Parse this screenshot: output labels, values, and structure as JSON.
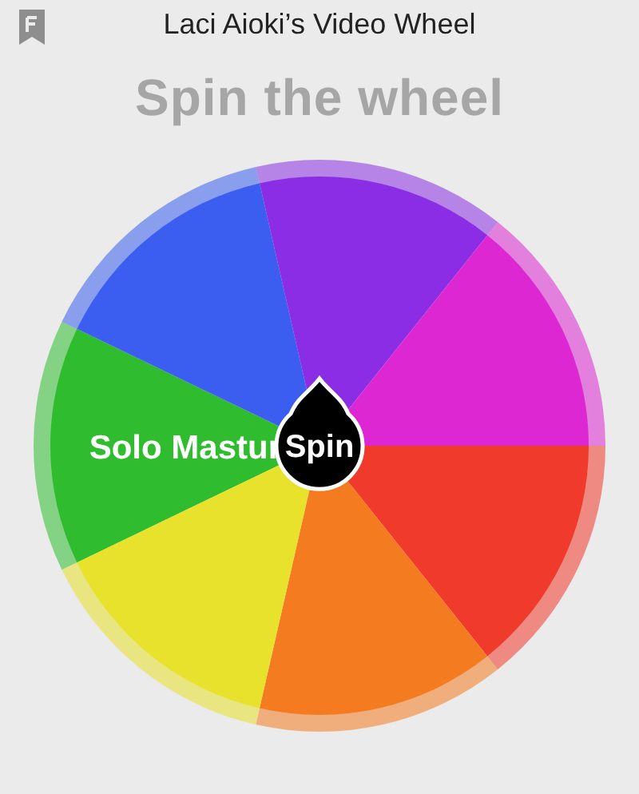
{
  "header": {
    "title": "Laci Aioki’s Video Wheel"
  },
  "heading": "Spin the wheel",
  "wheel": {
    "segments": [
      {
        "color": "#2fbd2f",
        "label": "Solo Mastur"
      },
      {
        "color": "#3b5ef0"
      },
      {
        "color": "#8a2de4"
      },
      {
        "color": "#dd27d2"
      },
      {
        "color": "#f03a2c"
      },
      {
        "color": "#f47b20"
      },
      {
        "color": "#e8e22c"
      }
    ],
    "spin_button": "Spin"
  }
}
